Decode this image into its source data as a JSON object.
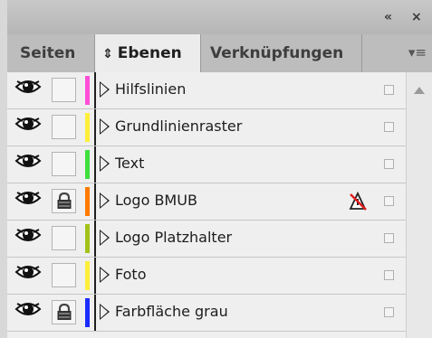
{
  "titlebar": {
    "collapse_icon": "double-chevron-left-icon",
    "collapse_glyph": "«",
    "close_icon": "close-icon",
    "close_glyph": "×"
  },
  "tabs": [
    {
      "label": "Seiten",
      "active": false
    },
    {
      "label": "Ebenen",
      "active": true,
      "icon": "sort-arrows-icon",
      "icon_glyph": "⇕"
    },
    {
      "label": "Verknüpfungen",
      "active": false
    }
  ],
  "panel_menu": {
    "icon": "panel-menu-icon",
    "glyph": "▾≡"
  },
  "layers": [
    {
      "name": "Hilfslinien",
      "visible": true,
      "locked": false,
      "color": "#ff4fd8",
      "warning": false
    },
    {
      "name": "Grundlinienraster",
      "visible": true,
      "locked": false,
      "color": "#ffee3a",
      "warning": false
    },
    {
      "name": "Text",
      "visible": true,
      "locked": false,
      "color": "#3fdf3f",
      "warning": false
    },
    {
      "name": "Logo BMUB",
      "visible": true,
      "locked": true,
      "color": "#ff7a00",
      "warning": true
    },
    {
      "name": "Logo Platzhalter",
      "visible": true,
      "locked": false,
      "color": "#a3c21a",
      "warning": false
    },
    {
      "name": "Foto",
      "visible": true,
      "locked": false,
      "color": "#ffee3a",
      "warning": false
    },
    {
      "name": "Farbfläche grau",
      "visible": true,
      "locked": true,
      "color": "#1a2cff",
      "warning": false
    }
  ]
}
